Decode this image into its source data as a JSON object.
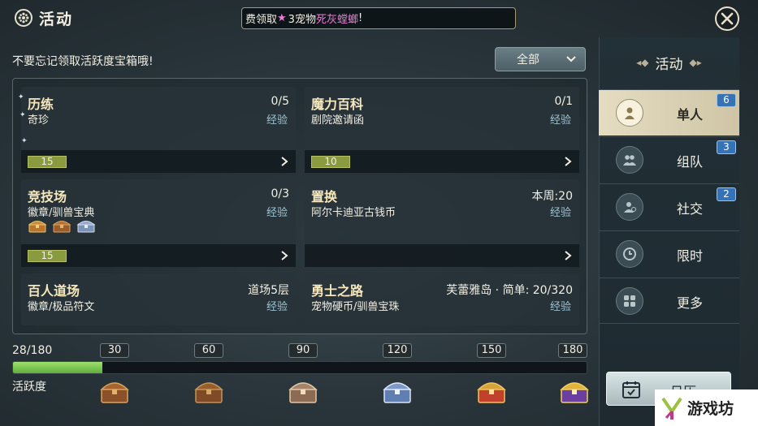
{
  "header": {
    "title": "活动",
    "marquee": {
      "prefix": "费领取 ",
      "star": "★",
      "middle": "3宠物",
      "highlight": "死灰螳螂",
      "suffix": "!"
    }
  },
  "reminder": "不要忘记领取活跃度宝箱哦!",
  "filter": {
    "selected": "全部"
  },
  "cards": [
    {
      "name": "历练",
      "progress": "0/5",
      "sub": "奇珍",
      "exp": "经验",
      "level": "15"
    },
    {
      "name": "魔力百科",
      "progress": "0/1",
      "sub": "剧院邀请函",
      "exp": "经验",
      "level": "10"
    },
    {
      "name": "竞技场",
      "progress": "0/3",
      "sub": "徽章/驯兽宝典",
      "exp": "经验",
      "level": "15"
    },
    {
      "name": "置换",
      "progress": "本周:20",
      "sub": "阿尔卡迪亚古钱币",
      "exp": "经验",
      "level": ""
    },
    {
      "name": "百人道场",
      "progress": "道场5层",
      "sub": "徽章/极品符文",
      "exp": "经验"
    },
    {
      "name": "勇士之路",
      "progress": "芙蕾雅岛 · 简单: 20/320",
      "sub": "宠物硬币/驯兽宝珠",
      "exp": "经验"
    }
  ],
  "activity": {
    "count_text": "28/180",
    "current": 28,
    "max": 180,
    "label": "活跃度",
    "milestones": [
      "30",
      "60",
      "90",
      "120",
      "150",
      "180"
    ]
  },
  "nav": {
    "header": "活动",
    "items": [
      {
        "label": "单人",
        "badge": "6",
        "icon": "person-icon"
      },
      {
        "label": "组队",
        "badge": "3",
        "icon": "group-icon"
      },
      {
        "label": "社交",
        "badge": "2",
        "icon": "social-icon"
      },
      {
        "label": "限时",
        "badge": "",
        "icon": "clock-icon"
      },
      {
        "label": "更多",
        "badge": "",
        "icon": "grid-icon"
      }
    ]
  },
  "calendar": {
    "label": "日历"
  },
  "watermark": {
    "text": "游戏坊"
  },
  "colors": {
    "accent_title": "#f6e7bd",
    "exp_blue": "#9cc4d4",
    "bar_green": "#7cc654",
    "badge_blue": "#3673b6",
    "highlight_pink": "#ef7bd6"
  }
}
